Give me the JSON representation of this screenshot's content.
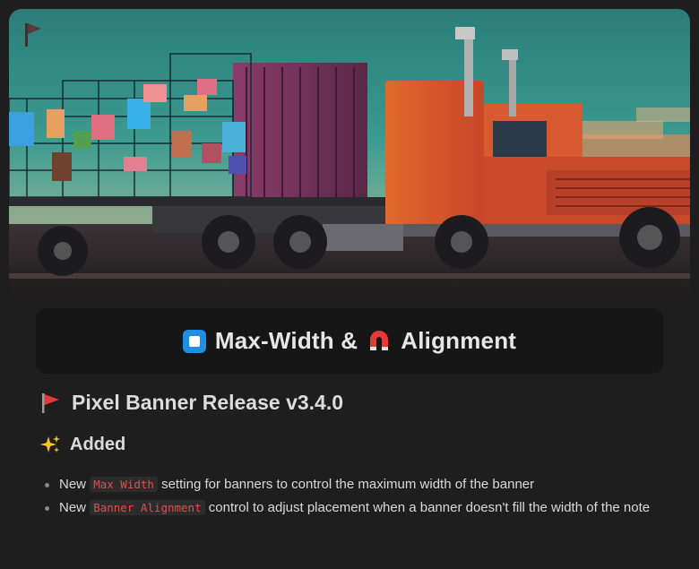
{
  "banner": {
    "alt_icon": "flag-icon",
    "icon": "corner-flag-icon"
  },
  "title": {
    "left_icon": "stop-button-icon",
    "text_part1": "Max-Width &",
    "right_icon": "magnet-icon",
    "text_part2": "Alignment"
  },
  "release": {
    "icon": "red-flag-icon",
    "text": "Pixel Banner Release v3.4.0"
  },
  "added": {
    "icon": "sparkles-icon",
    "text": "Added"
  },
  "notes": [
    {
      "before": "New ",
      "code": "Max Width",
      "after": " setting for banners to control the maximum width of the banner"
    },
    {
      "before": "New ",
      "code": "Banner Alignment",
      "after": " control to adjust placement when a banner doesn't fill the width of the note"
    }
  ],
  "colors": {
    "background": "#1e1e1e",
    "card": "#161616",
    "code_text": "#e0504a",
    "accent_blue": "#1e8fe0"
  }
}
